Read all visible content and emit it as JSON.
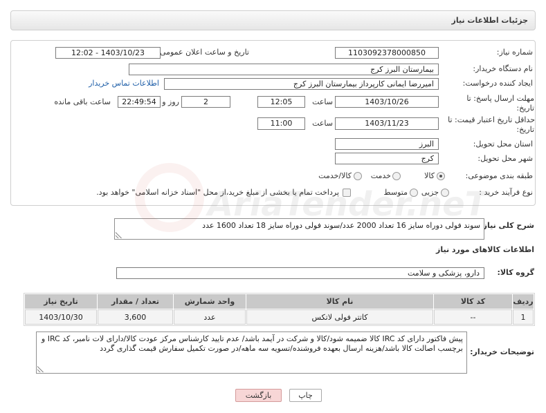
{
  "header": {
    "title": "جزئیات اطلاعات نیاز"
  },
  "fields": {
    "need_number": {
      "label": "شماره نیاز:",
      "value": "1103092378000850"
    },
    "announce_datetime": {
      "label": "تاریخ و ساعت اعلان عمومی:",
      "value": "1403/10/23 - 12:02"
    },
    "buyer_org": {
      "label": "نام دستگاه خریدار:",
      "value": "بیمارستان البرز کرج"
    },
    "requester": {
      "label": "ایجاد کننده درخواست:",
      "value": "امیررضا ایمانی کارپرداز بیمارستان البرز کرج",
      "contact_link": "اطلاعات تماس خریدار"
    },
    "response_deadline": {
      "label_line1": "مهلت ارسال پاسخ: تا",
      "label_line2": "تاریخ:",
      "date": "1403/10/26",
      "time_label": "ساعت",
      "time": "12:05",
      "days": "2",
      "days_label": "روز و",
      "remaining_time": "22:49:54",
      "remaining_label": "ساعت باقی مانده"
    },
    "price_validity": {
      "label_line1": "حداقل تاریخ اعتبار قیمت: تا",
      "label_line2": "تاریخ:",
      "date": "1403/11/23",
      "time_label": "ساعت",
      "time": "11:00"
    },
    "province": {
      "label": "استان محل تحویل:",
      "value": "البرز"
    },
    "city": {
      "label": "شهر محل تحویل:",
      "value": "کرج"
    },
    "category": {
      "label": "طبقه بندی موضوعی:",
      "options": [
        {
          "label": "کالا",
          "selected": true
        },
        {
          "label": "خدمت",
          "selected": false
        },
        {
          "label": "کالا/خدمت",
          "selected": false
        }
      ]
    },
    "process_type": {
      "label": "نوع فرآیند خرید :",
      "options": [
        {
          "label": "جزیی",
          "selected": false
        },
        {
          "label": "متوسط",
          "selected": false
        }
      ],
      "treasury_checkbox": {
        "label": "پرداخت تمام یا بخشی از مبلغ خرید،از محل \"اسناد خزانه اسلامی\" خواهد بود.",
        "checked": false
      }
    }
  },
  "description": {
    "label": "شرح کلی نیاز:",
    "value": "سوند فولی دوراه سایز 16 تعداد 2000 عدد/سوند فولی دوراه سایز 18 تعداد 1600 عدد"
  },
  "goods_section": {
    "title": "اطلاعات کالاهای مورد نیاز",
    "group_label": "گروه کالا:",
    "group_value": "دارو، پزشکی و سلامت"
  },
  "table": {
    "columns": [
      "ردیف",
      "کد کالا",
      "نام کالا",
      "واحد شمارش",
      "تعداد / مقدار",
      "تاریخ نیاز"
    ],
    "rows": [
      [
        "1",
        "--",
        "کاتتر فولی لاتکس",
        "عدد",
        "3,600",
        "1403/10/30"
      ]
    ]
  },
  "buyer_notes": {
    "label": "توضیحات خریدار:",
    "value": "پیش فاکتور دارای کد IRC کالا ضمیمه شود/کالا و شرکت در آیمد باشد/ عدم تایید کارشناس مرکز عودت کالا/دارای لات نامبر، کد IRC و برچسب اصالت کالا باشد/هزینه ارسال بعهده فروشنده/تسویه سه ماهه/در صورت تکمیل سفارش قیمت گذاری گردد"
  },
  "buttons": {
    "print": "چاپ",
    "back": "بازگشت"
  },
  "watermark": "AriaTender.neT",
  "colors": {
    "link": "#1f5fa8",
    "back_button_bg": "#f7d6d6",
    "back_button_border": "#d49a9a",
    "table_header_bg": "#c9c9c9",
    "table_cell_bg": "#f4f4f4",
    "panel_border": "#cfcfcf",
    "field_border": "#7b7b7b",
    "text": "#333333",
    "watermark_logo": "#c0392b"
  }
}
